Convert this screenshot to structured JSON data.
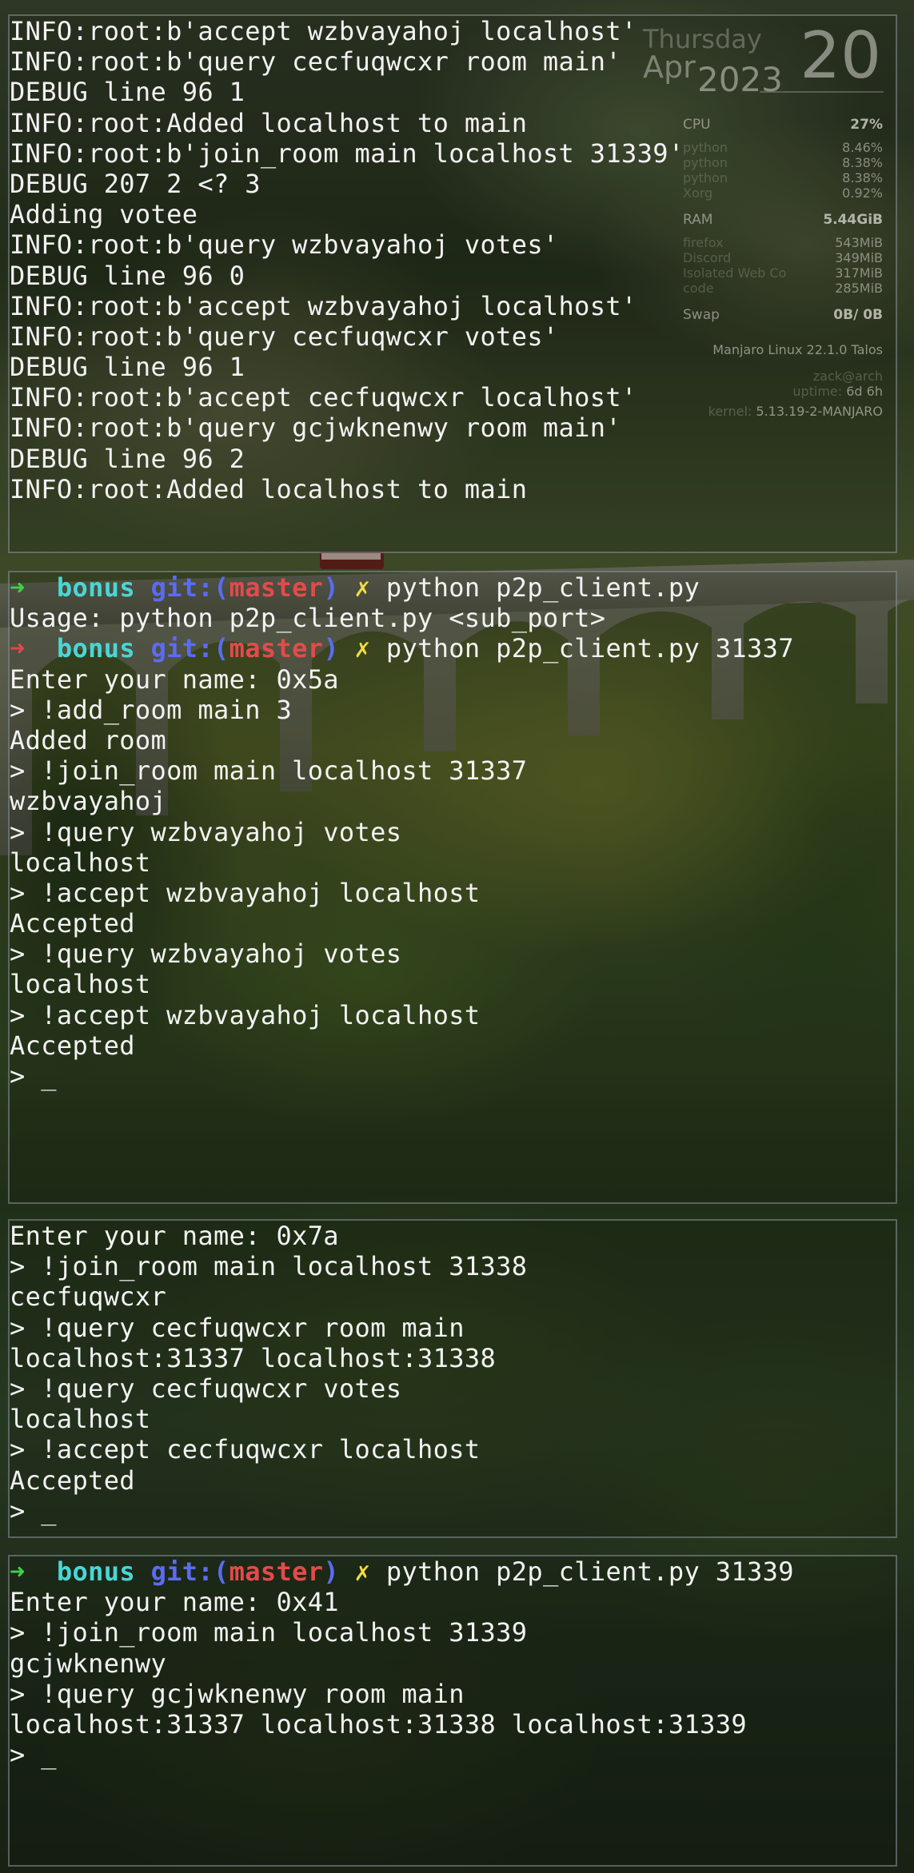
{
  "conky": {
    "weekday": "Thursday",
    "month": "Apr",
    "year": "2023",
    "day": "20",
    "cpu": {
      "label": "CPU",
      "value": "27%"
    },
    "cpu_processes": [
      {
        "name": "python",
        "value": "8.46%"
      },
      {
        "name": "python",
        "value": "8.38%"
      },
      {
        "name": "python",
        "value": "8.38%"
      },
      {
        "name": "Xorg",
        "value": "0.92%"
      }
    ],
    "ram": {
      "label": "RAM",
      "value": "5.44GiB"
    },
    "ram_processes": [
      {
        "name": "firefox",
        "value": "543MiB"
      },
      {
        "name": "Discord",
        "value": "349MiB"
      },
      {
        "name": "Isolated Web Co",
        "value": "317MiB"
      },
      {
        "name": "code",
        "value": "285MiB"
      }
    ],
    "swap": {
      "label": "Swap",
      "value": "0B/ 0B"
    },
    "os": "Manjaro Linux 22.1.0 Talos",
    "user_host": "zack@arch",
    "uptime_label": "uptime:",
    "uptime_value": "6d 6h",
    "kernel_label": "kernel:",
    "kernel_value": "5.13.19-2-MANJARO"
  },
  "terminal1": {
    "lines": [
      "INFO:root:b'accept wzbvayahoj localhost'",
      "INFO:root:b'query cecfuqwcxr room main'",
      "DEBUG line 96 1",
      "INFO:root:Added localhost to main",
      "INFO:root:b'join_room main localhost 31339'",
      "DEBUG 207 2 <? 3",
      "Adding votee",
      "INFO:root:b'query wzbvayahoj votes'",
      "DEBUG line 96 0",
      "INFO:root:b'accept wzbvayahoj localhost'",
      "INFO:root:b'query cecfuqwcxr votes'",
      "DEBUG line 96 1",
      "INFO:root:b'accept cecfuqwcxr localhost'",
      "INFO:root:b'query gcjwknenwy room main'",
      "DEBUG line 96 2",
      "INFO:root:Added localhost to main",
      "",
      "_"
    ]
  },
  "terminal2": {
    "prompt": {
      "arrow": "➜",
      "dir": "bonus",
      "git_label": "git:(",
      "branch": "master",
      "git_close": ")",
      "dirty": "✗"
    },
    "cmd1": "python p2p_client.py",
    "out1": "Usage: python p2p_client.py <sub_port>",
    "cmd2": "python p2p_client.py 31337",
    "lines": [
      "Enter your name: 0x5a",
      "> !add_room main 3",
      "Added room",
      "> !join_room main localhost 31337",
      "wzbvayahoj",
      "> !query wzbvayahoj votes",
      "localhost",
      "> !accept wzbvayahoj localhost",
      "Accepted",
      "> !query wzbvayahoj votes",
      "localhost",
      "> !accept wzbvayahoj localhost",
      "Accepted",
      "> _"
    ]
  },
  "terminal3": {
    "lines": [
      "Enter your name: 0x7a",
      "> !join_room main localhost 31338",
      "cecfuqwcxr",
      "> !query cecfuqwcxr room main",
      "localhost:31337 localhost:31338",
      "> !query cecfuqwcxr votes",
      "localhost",
      "> !accept cecfuqwcxr localhost",
      "Accepted",
      "> _"
    ]
  },
  "terminal4": {
    "cmd": "python p2p_client.py 31339",
    "lines": [
      "Enter your name: 0x41",
      "> !join_room main localhost 31339",
      "gcjwknenwy",
      "> !query gcjwknenwy room main",
      "localhost:31337 localhost:31338 localhost:31339",
      "> _"
    ]
  }
}
